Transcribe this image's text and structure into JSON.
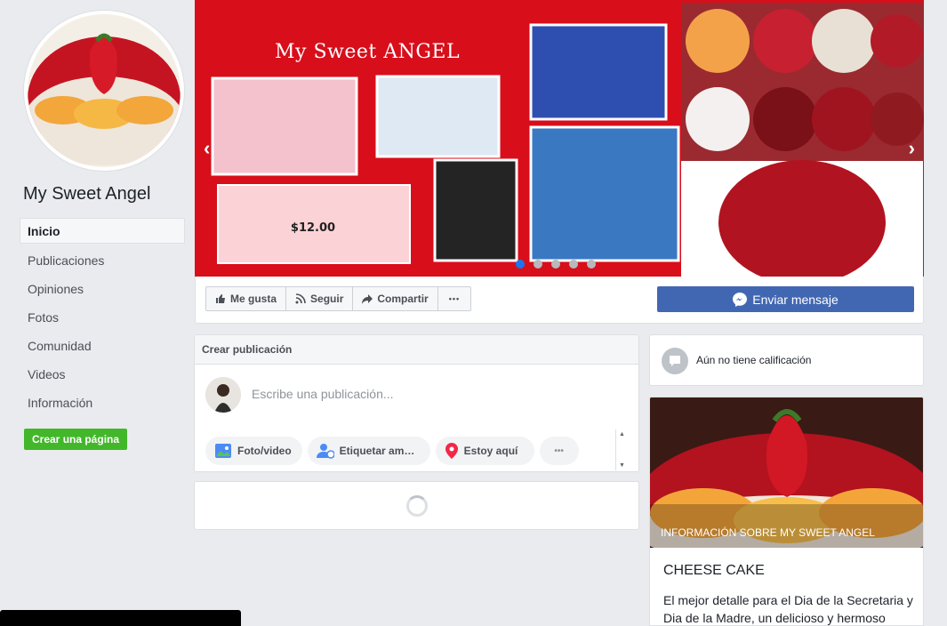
{
  "page": {
    "name": "My Sweet Angel"
  },
  "nav": {
    "items": [
      {
        "label": "Inicio",
        "active": true
      },
      {
        "label": "Publicaciones"
      },
      {
        "label": "Opiniones"
      },
      {
        "label": "Fotos"
      },
      {
        "label": "Comunidad"
      },
      {
        "label": "Videos"
      },
      {
        "label": "Información"
      }
    ],
    "create_page": "Crear una página"
  },
  "cover": {
    "title": "My Sweet ANGEL",
    "slide_count": 5,
    "active_slide": 1
  },
  "actions": {
    "like": "Me gusta",
    "follow": "Seguir",
    "share": "Compartir",
    "more": "•••",
    "send_message": "Enviar mensaje"
  },
  "composer": {
    "header": "Crear publicación",
    "placeholder": "Escribe una publicación...",
    "options": [
      {
        "label": "Foto/video",
        "icon": "photo-icon"
      },
      {
        "label": "Etiquetar am…",
        "icon": "tag-friends-icon"
      },
      {
        "label": "Estoy aquí",
        "icon": "location-pin-icon"
      }
    ]
  },
  "rating": {
    "text": "Aún no tiene calificación"
  },
  "about": {
    "image_label": "INFORMACIÓN SOBRE MY SWEET ANGEL",
    "title": "CHEESE CAKE",
    "description": "El mejor detalle para el Dia de la Secretaria y Dia de la Madre, un delicioso y hermoso"
  },
  "colors": {
    "facebook_blue": "#4267b2",
    "green": "#42b72a",
    "cover_red": "#d80e1b"
  }
}
